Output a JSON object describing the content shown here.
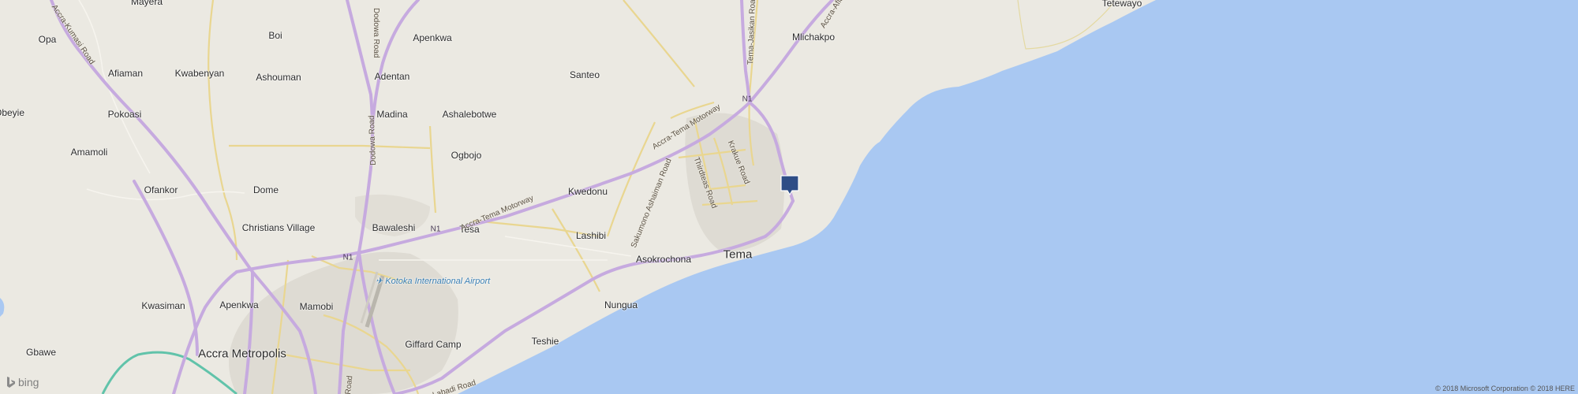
{
  "map": {
    "colors": {
      "land": "#ebe9e2",
      "sea": "#a9c8f2",
      "major_road": "#c3a8de",
      "road": "#e9d690",
      "urban": "#dcdad3",
      "marker": "#2e4d86",
      "rail": "#61c3aa"
    },
    "places": {
      "mayera": "Mayera",
      "opa": "Opa",
      "boi": "Boi",
      "apenkwa_north": "Apenkwa",
      "mlichakpo": "Mlichakpo",
      "tetewayo": "Tetewayo",
      "afiaman": "Afiaman",
      "kwabenyan": "Kwabenyan",
      "ashouman": "Ashouman",
      "adentan": "Adentan",
      "santeo": "Santeo",
      "obeyie": "Obeyie",
      "pokoasi": "Pokoasi",
      "madina": "Madina",
      "ashalebotwe": "Ashalebotwe",
      "amamoli": "Amamoli",
      "ogbojo": "Ogbojo",
      "ofankor": "Ofankor",
      "dome": "Dome",
      "kwedonu": "Kwedonu",
      "christians_village": "Christians Village",
      "bawaleshi": "Bawaleshi",
      "tesa": "Tesa",
      "lashibi": "Lashibi",
      "asokrochona": "Asokrochona",
      "tema": "Tema",
      "kwasiman": "Kwasiman",
      "apenkwa_south": "Apenkwa",
      "mamobi": "Mamobi",
      "nungua": "Nungua",
      "gbawe": "Gbawe",
      "accra_metropolis": "Accra Metropolis",
      "giffard_camp": "Giffard Camp",
      "teshie": "Teshie",
      "airport": "Kotoka International Airport"
    },
    "roads": {
      "accra_kumasi": "Accra-Kumasi Road",
      "dodowa_north": "Dodowa Road",
      "dodowa_south": "Dodowa Road",
      "tema_jasikan": "Tema-Jasikan Road",
      "accra_aflao": "Accra-Afla",
      "motorway_east": "Accra-Tema Motorway",
      "motorway_west": "Accra-Tema Motorway",
      "krakue": "Krakue Road",
      "thirdteas": "Thirdteas Road",
      "sakumono": "Sakumono Ashaiman Road",
      "labadi": "Labadi Road",
      "road_stub": "Road",
      "n1_east": "N1",
      "n1_mid": "N1",
      "n1_west": "N1"
    },
    "branding": "bing",
    "copyright": "© 2018 Microsoft Corporation © 2018 HERE"
  }
}
